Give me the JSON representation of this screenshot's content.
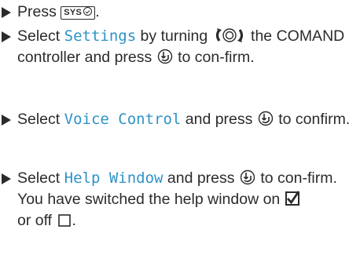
{
  "steps": [
    {
      "prefix": "Press ",
      "key_label": "SYS",
      "suffix": "."
    },
    {
      "a": "Select ",
      "hl": "Settings",
      "b": " by turning ",
      "c": " the COMAND controller and press ",
      "d": " to con-firm."
    },
    {
      "a": "Select ",
      "hl": "Voice Control",
      "b": " and press ",
      "c": " to confirm."
    },
    {
      "a": "Select ",
      "hl": "Help Window",
      "b": " and press ",
      "c": " to con-firm.",
      "note_a": "You have switched the help window on ",
      "note_b": "or off ",
      "note_c": "."
    }
  ],
  "colors": {
    "highlight": "#2e93c8",
    "text": "#2b2b2b"
  },
  "icons": [
    "triangle-bullet-icon",
    "sys-key-icon",
    "rotate-controller-icon",
    "press-controller-icon",
    "checkbox-checked-icon",
    "checkbox-empty-icon"
  ]
}
